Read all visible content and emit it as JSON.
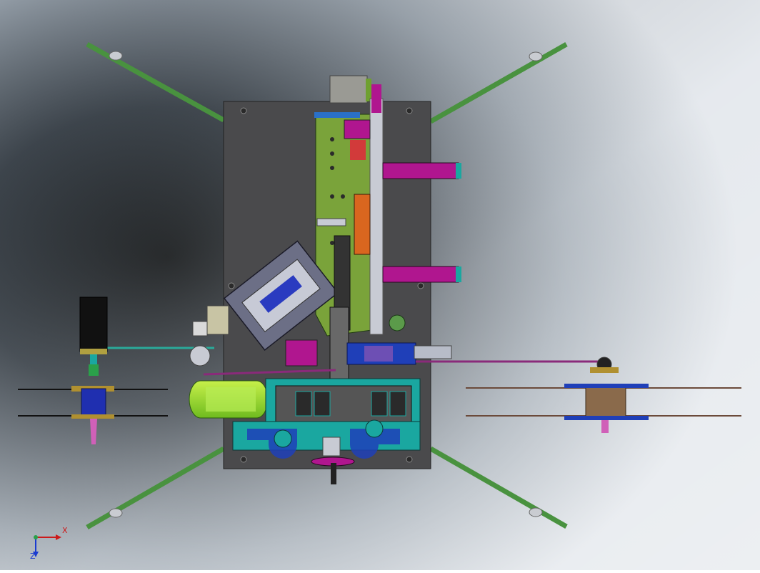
{
  "scene": {
    "background": {
      "top": "#9fa8b3",
      "dark": "#1e2227",
      "light": "#d8dde4"
    },
    "colors": {
      "base_plate": "#4a4a4c",
      "green_plate": "#7aa33a",
      "magenta": "#b0168f",
      "blue": "#1f3fb8",
      "cyan": "#1aa7a0",
      "orange": "#d9661f",
      "lime": "#9adf2f",
      "gray_box": "#6c6f86",
      "legs": "#4f9a4a",
      "reel_core": "#8a6a4b",
      "motor_black": "#111111"
    }
  },
  "triad": {
    "x_label": "X",
    "z_label": "Z"
  }
}
